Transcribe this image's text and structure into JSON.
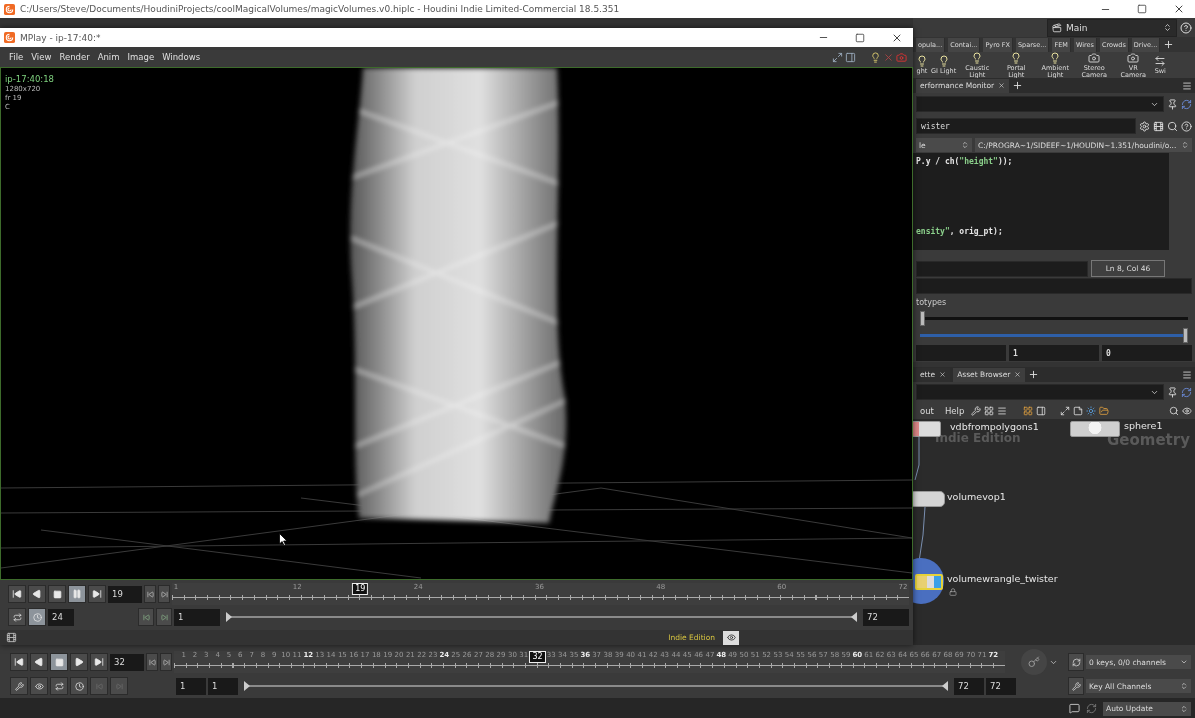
{
  "app_window": {
    "title": "C:/Users/Steve/Documents/HoudiniProjects/coolMagicalVolumes/magicVolumes.v0.hiplc - Houdini Indie Limited-Commercial 18.5.351"
  },
  "desktop": {
    "label": "Main"
  },
  "shelf": {
    "tabs": [
      {
        "label": "opula..."
      },
      {
        "label": "Contai..."
      },
      {
        "label": "Pyro FX"
      },
      {
        "label": "Sparse..."
      },
      {
        "label": "FEM"
      },
      {
        "label": "Wires"
      },
      {
        "label": "Crowds"
      },
      {
        "label": "Drive..."
      }
    ],
    "tools": [
      {
        "label": "ght",
        "kind": "light"
      },
      {
        "label": "GI Light",
        "kind": "light"
      },
      {
        "label": "Caustic Light",
        "kind": "light"
      },
      {
        "label": "Portal Light",
        "kind": "light"
      },
      {
        "label": "Ambient Light",
        "kind": "light"
      },
      {
        "label": "Stereo Camera",
        "kind": "camera"
      },
      {
        "label": "VR Camera",
        "kind": "camera"
      },
      {
        "label": "Swi",
        "kind": "switcher"
      }
    ]
  },
  "parameter_pane": {
    "tabs": [
      {
        "label": "erformance Monitor",
        "selected": true
      }
    ],
    "node_name": "wister",
    "mode": "le",
    "vex_path": "C:/PROGRA~1/SIDEEF~1/HOUDIN~1.351/houdini/o...",
    "code_lines": [
      {
        "tokens": [
          {
            "text": "P.y / ch(",
            "kind": "plain"
          },
          {
            "text": "\"height\"",
            "kind": "string"
          },
          {
            "text": "));",
            "kind": "plain"
          }
        ]
      },
      {
        "tokens": [
          {
            "text": "ensity\"",
            "kind": "string"
          },
          {
            "text": ", orig_pt);",
            "kind": "plain"
          }
        ]
      }
    ],
    "cursor_position": "Ln 8, Col 46",
    "section": "totypes",
    "sliders": [
      {
        "level": 0
      },
      {
        "level": 1
      }
    ],
    "values": [
      "1",
      "0"
    ]
  },
  "network_pane": {
    "tabs": [
      {
        "label": "ette",
        "selected": false
      },
      {
        "label": "Asset Browser",
        "selected": true
      }
    ],
    "menu": [
      "out",
      "Help"
    ],
    "nodes": [
      {
        "name": "vdbfrompolygons1",
        "kind": "vdb",
        "selected": false,
        "display": false,
        "locked": false
      },
      {
        "name": "sphere1",
        "kind": "sphere",
        "selected": false,
        "display": false,
        "locked": false
      },
      {
        "name": "volumevop1",
        "kind": "vop",
        "selected": false,
        "display": false,
        "locked": false
      },
      {
        "name": "volumewrangle_twister",
        "kind": "wrangle",
        "selected": true,
        "display": true,
        "locked": true
      }
    ],
    "edition": "Indie Edition",
    "context": "Geometry"
  },
  "mplay": {
    "title": "MPlay - ip-17:40:*",
    "menu": [
      "File",
      "View",
      "Render",
      "Anim",
      "Image",
      "Windows"
    ],
    "info": [
      "ip-17:40:18",
      "1280x720",
      "fr 19",
      "C"
    ],
    "transport": [
      {
        "kind": "first",
        "selected": false
      },
      {
        "kind": "reverse",
        "selected": false
      },
      {
        "kind": "stop",
        "selected": false
      },
      {
        "kind": "pause",
        "selected": true
      },
      {
        "kind": "last",
        "selected": false
      }
    ],
    "frame": "19",
    "fps": "24",
    "range_start": "1",
    "range_end": "72",
    "range_handles": [
      {
        "level": 0
      },
      {
        "level": 1
      }
    ],
    "ruler": {
      "current": "19",
      "level": 0.2535,
      "labels": [
        {
          "label": "1",
          "major": false
        },
        {
          "label": "12",
          "major": false
        },
        {
          "label": "24",
          "major": false
        },
        {
          "label": "36",
          "major": false
        },
        {
          "label": "48",
          "major": false
        },
        {
          "label": "60",
          "major": false
        },
        {
          "label": "72",
          "major": false
        }
      ]
    },
    "edition": "Indie Edition"
  },
  "main_timeline": {
    "transport": [
      {
        "kind": "first",
        "selected": false
      },
      {
        "kind": "reverse",
        "selected": false
      },
      {
        "kind": "stop",
        "selected": true
      },
      {
        "kind": "play",
        "selected": false
      },
      {
        "kind": "last",
        "selected": false
      }
    ],
    "frame": "32",
    "range_handles": [
      {
        "level": 0
      },
      {
        "level": 1
      }
    ],
    "range_start": [
      "1",
      "1"
    ],
    "range_end": [
      "72",
      "72"
    ],
    "keys": "0 keys, 0/0 channels",
    "key_mode": "Key All Channels",
    "ruler": {
      "current": "32",
      "level": 0.4366,
      "labels": [
        {
          "label": "1",
          "major": false
        },
        {
          "label": "2",
          "major": false
        },
        {
          "label": "3",
          "major": false
        },
        {
          "label": "4",
          "major": false
        },
        {
          "label": "5",
          "major": false
        },
        {
          "label": "6",
          "major": false
        },
        {
          "label": "7",
          "major": false
        },
        {
          "label": "8",
          "major": false
        },
        {
          "label": "9",
          "major": false
        },
        {
          "label": "10",
          "major": false
        },
        {
          "label": "11",
          "major": false
        },
        {
          "label": "12",
          "major": true
        },
        {
          "label": "13",
          "major": false
        },
        {
          "label": "14",
          "major": false
        },
        {
          "label": "15",
          "major": false
        },
        {
          "label": "16",
          "major": false
        },
        {
          "label": "17",
          "major": false
        },
        {
          "label": "18",
          "major": false
        },
        {
          "label": "19",
          "major": false
        },
        {
          "label": "20",
          "major": false
        },
        {
          "label": "21",
          "major": false
        },
        {
          "label": "22",
          "major": false
        },
        {
          "label": "23",
          "major": false
        },
        {
          "label": "24",
          "major": true
        },
        {
          "label": "25",
          "major": false
        },
        {
          "label": "26",
          "major": false
        },
        {
          "label": "27",
          "major": false
        },
        {
          "label": "28",
          "major": false
        },
        {
          "label": "29",
          "major": false
        },
        {
          "label": "30",
          "major": false
        },
        {
          "label": "31",
          "major": false
        },
        {
          "label": "33",
          "major": false
        },
        {
          "label": "34",
          "major": false
        },
        {
          "label": "35",
          "major": false
        },
        {
          "label": "36",
          "major": true
        },
        {
          "label": "37",
          "major": false
        },
        {
          "label": "38",
          "major": false
        },
        {
          "label": "39",
          "major": false
        },
        {
          "label": "40",
          "major": false
        },
        {
          "label": "41",
          "major": false
        },
        {
          "label": "42",
          "major": false
        },
        {
          "label": "43",
          "major": false
        },
        {
          "label": "44",
          "major": false
        },
        {
          "label": "45",
          "major": false
        },
        {
          "label": "46",
          "major": false
        },
        {
          "label": "47",
          "major": false
        },
        {
          "label": "48",
          "major": true
        },
        {
          "label": "49",
          "major": false
        },
        {
          "label": "50",
          "major": false
        },
        {
          "label": "51",
          "major": false
        },
        {
          "label": "52",
          "major": false
        },
        {
          "label": "53",
          "major": false
        },
        {
          "label": "54",
          "major": false
        },
        {
          "label": "55",
          "major": false
        },
        {
          "label": "56",
          "major": false
        },
        {
          "label": "57",
          "major": false
        },
        {
          "label": "58",
          "major": false
        },
        {
          "label": "59",
          "major": false
        },
        {
          "label": "60",
          "major": true
        },
        {
          "label": "61",
          "major": false
        },
        {
          "label": "62",
          "major": false
        },
        {
          "label": "63",
          "major": false
        },
        {
          "label": "64",
          "major": false
        },
        {
          "label": "65",
          "major": false
        },
        {
          "label": "66",
          "major": false
        },
        {
          "label": "67",
          "major": false
        },
        {
          "label": "68",
          "major": false
        },
        {
          "label": "69",
          "major": false
        },
        {
          "label": "70",
          "major": false
        },
        {
          "label": "71",
          "major": false
        },
        {
          "label": "72",
          "major": true
        }
      ]
    }
  },
  "status_bar": {
    "update_mode": "Auto Update"
  }
}
